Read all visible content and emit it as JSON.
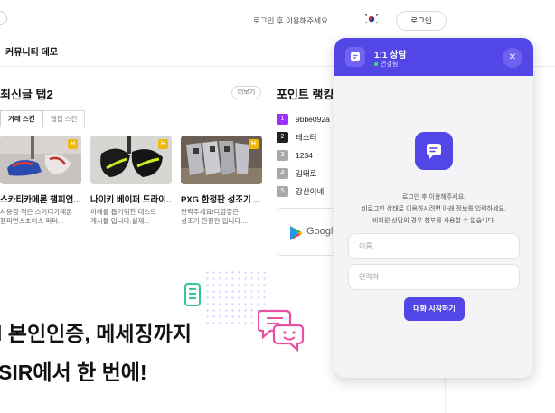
{
  "topbar": {
    "login_notice": "로그인 후 이용해주세요.",
    "login_button": "로그인",
    "flag_icon": "korea-flag-icon"
  },
  "site": {
    "name": "커뮤니티 데모"
  },
  "latest": {
    "title": "최신글 탭2",
    "more_label": "더보기",
    "tabs": [
      {
        "label": "거래 스킨",
        "active": true
      },
      {
        "label": "웹접 스킨",
        "active": false
      }
    ],
    "cards": [
      {
        "badge": "H",
        "title": "스카티카메론 챔피언...",
        "desc_1": "사용감 적은 스카티카메론",
        "desc_2": "챔피언스초이스 퍼터..."
      },
      {
        "badge": "H",
        "title": "나이키 베이퍼 드라이...",
        "desc_1": "이해를 돕기위한 테스트",
        "desc_2": "게시물 입니다.실제..."
      },
      {
        "badge": "H",
        "title": "PXG 한정판 성조기 ...",
        "desc_1": "연락주세요!타감좋은",
        "desc_2": "성조기 한정판 입니다...."
      }
    ]
  },
  "ranking": {
    "title": "포인트 랭킹",
    "items": [
      {
        "rank": "1",
        "name": "9bbe092a",
        "color": "#9b30ff"
      },
      {
        "rank": "2",
        "name": "테스터",
        "color": "#222222"
      },
      {
        "rank": "3",
        "name": "1234",
        "color": "#a9a9a9"
      },
      {
        "rank": "4",
        "name": "김태로",
        "color": "#a9a9a9"
      },
      {
        "rank": "5",
        "name": "강산이네",
        "color": "#a9a9a9"
      }
    ],
    "ad_text": "Google"
  },
  "banner": {
    "line1": "l 본인인증, 메세징까지",
    "line2": "SIR에서 한 번에!"
  },
  "chat_widget": {
    "title": "1:1 상담",
    "status": "연결됨",
    "message_1": "로그인 후 이용해주세요.",
    "message_2": "비로그인 상태로 이용하시려면 아래 정보를 입력하세요.",
    "message_3": "비회원 상담의 경우 첨부를 사용할 수 없습니다.",
    "name_placeholder": "이름",
    "contact_placeholder": "연락처",
    "start_button": "대화 시작하기",
    "accent": "#5346e6"
  }
}
